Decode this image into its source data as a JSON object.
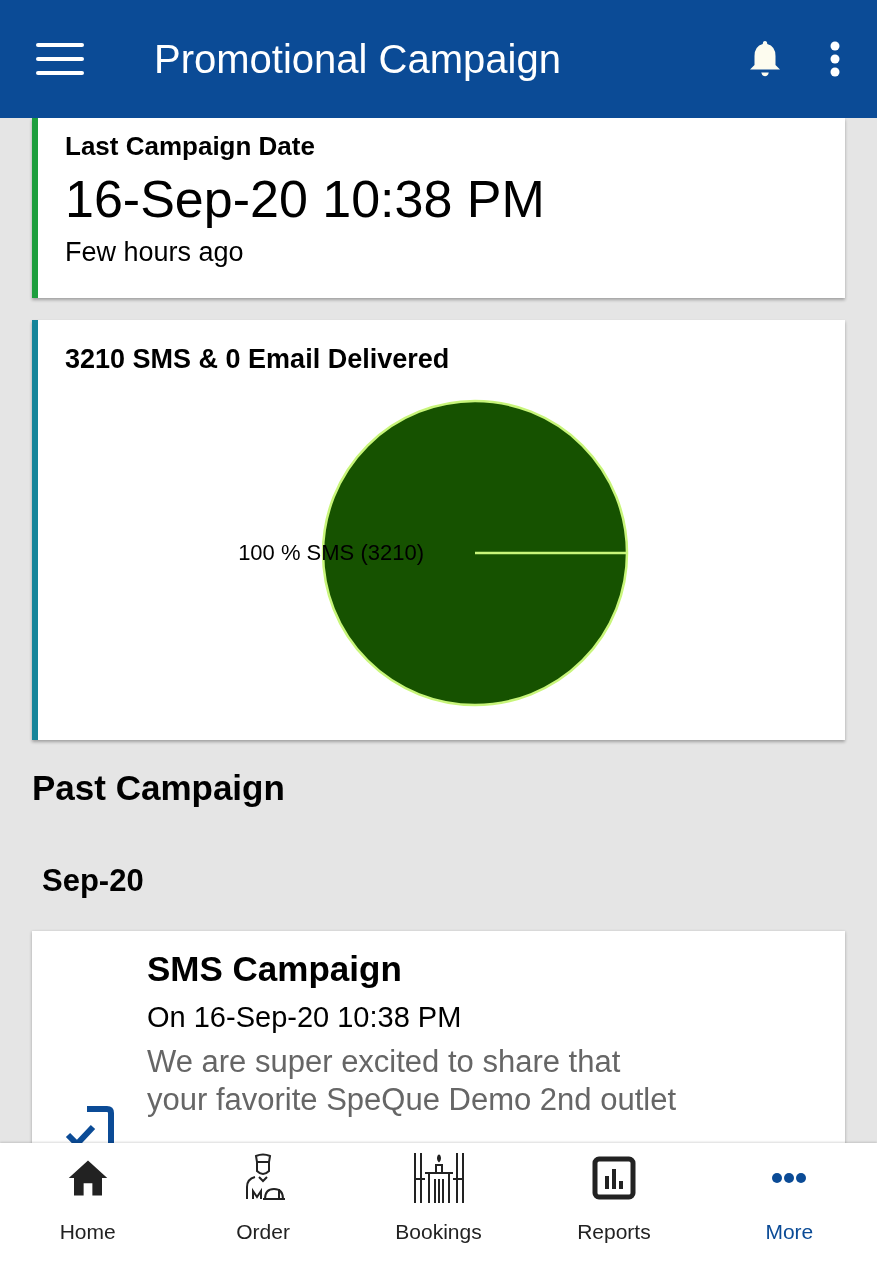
{
  "app_bar": {
    "title": "Promotional Campaign"
  },
  "last_campaign": {
    "label": "Last Campaign Date",
    "date": "16-Sep-20 10:38 PM",
    "relative": "Few hours ago",
    "color": "#1e9e3e"
  },
  "delivery": {
    "title": "3210 SMS & 0 Email Delivered",
    "color": "#16859a",
    "chart_data": {
      "type": "pie",
      "values": [
        100
      ],
      "colors": [
        "#165200"
      ],
      "value_labels": [
        "100 % SMS (3210)"
      ]
    }
  },
  "past_section": {
    "title": "Past Campaign",
    "month": "Sep-20"
  },
  "campaigns": [
    {
      "kind": "sms",
      "title": "SMS Campaign",
      "date": "On 16-Sep-20 10:38 PM",
      "lines": [
        "We are super excited to share that",
        "your favorite SpeQue Demo 2nd outlet"
      ]
    }
  ],
  "nav": [
    {
      "kind": "home",
      "label": "Home",
      "selected": false
    },
    {
      "kind": "order",
      "label": "Order",
      "selected": false
    },
    {
      "kind": "bookings",
      "label": "Bookings",
      "selected": false
    },
    {
      "kind": "reports",
      "label": "Reports",
      "selected": false
    },
    {
      "kind": "more",
      "label": "More",
      "selected": true
    }
  ]
}
